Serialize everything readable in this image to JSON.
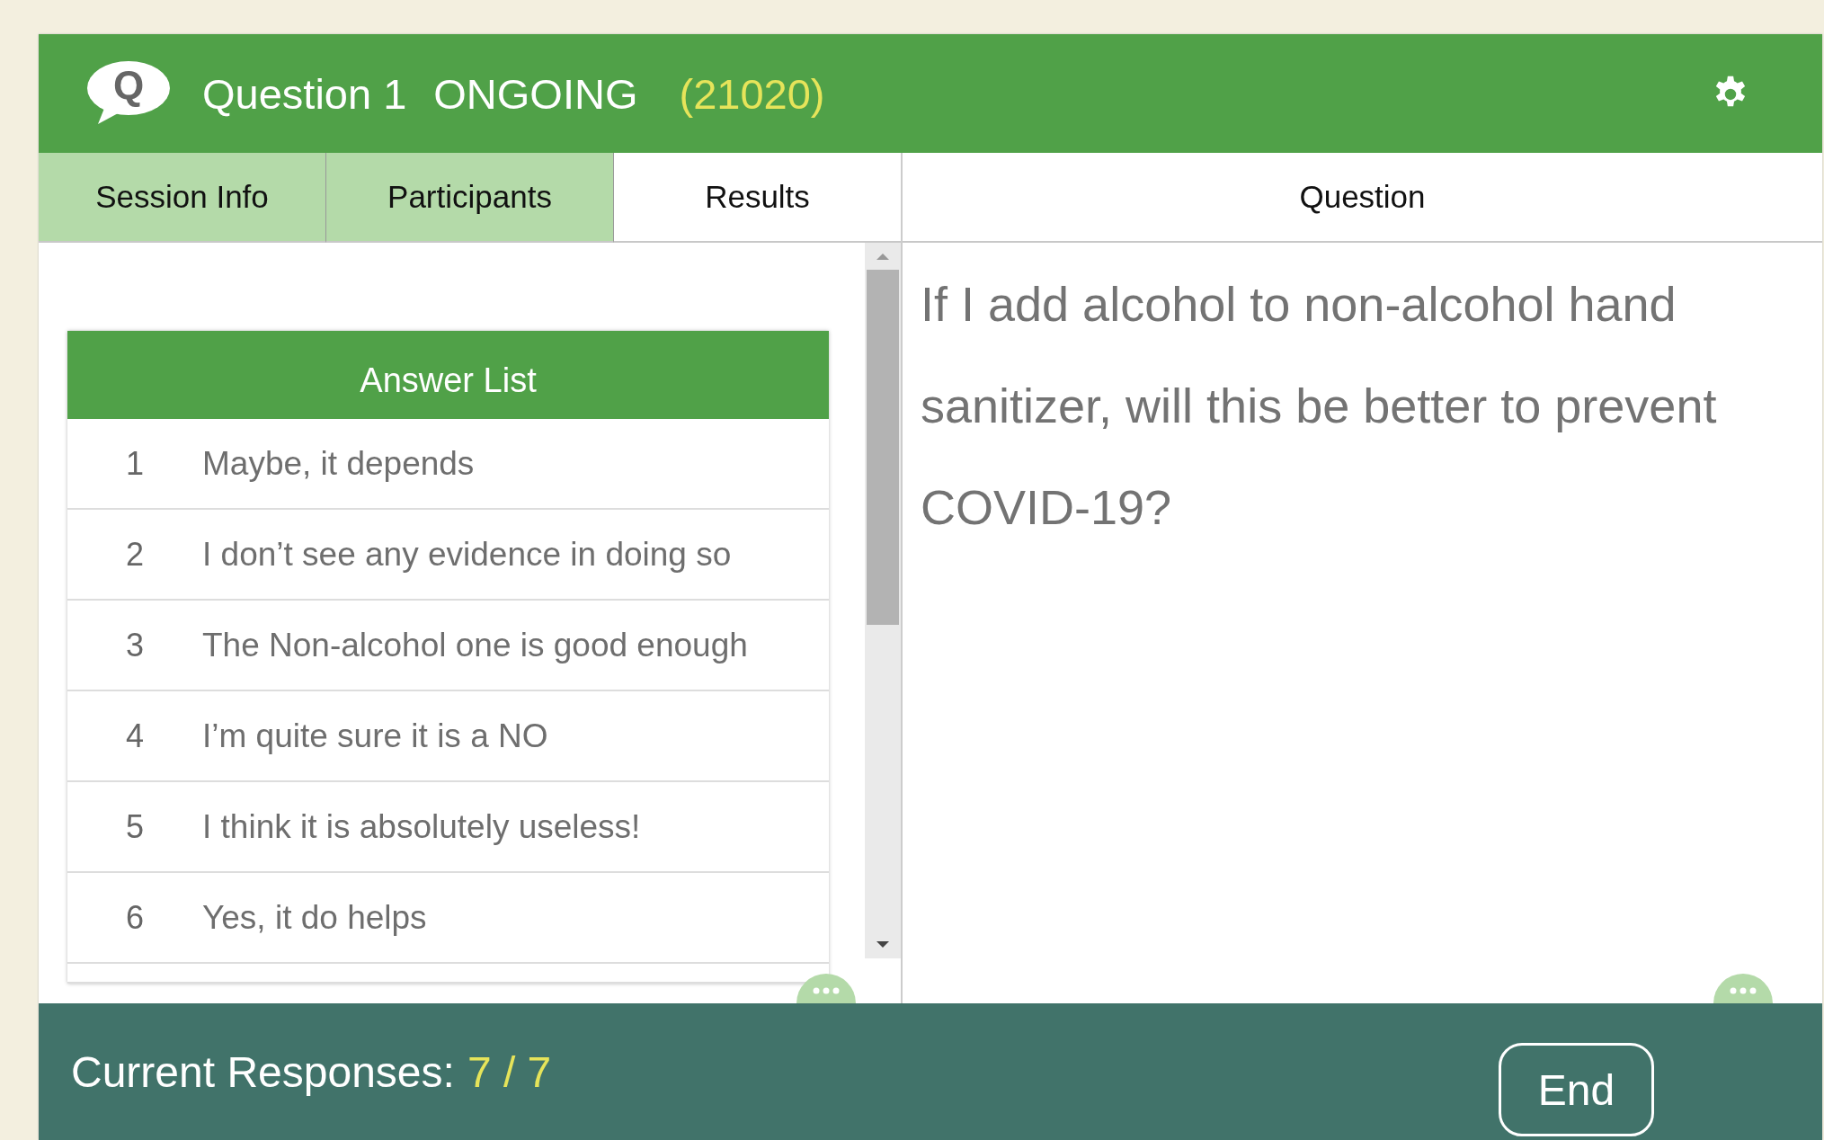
{
  "header": {
    "logo_letter": "Q",
    "title": "Question 1",
    "status": "ONGOING",
    "code": "(21020)"
  },
  "tabs": [
    {
      "label": "Session Info",
      "selected": false
    },
    {
      "label": "Participants",
      "selected": false
    },
    {
      "label": "Results",
      "selected": true
    }
  ],
  "answer_list": {
    "title": "Answer List",
    "rows": [
      {
        "number": "1",
        "answer": "Maybe, it depends"
      },
      {
        "number": "2",
        "answer": "I don’t see any evidence in doing so"
      },
      {
        "number": "3",
        "answer": "The Non-alcohol one is good enough"
      },
      {
        "number": "4",
        "answer": "I’m quite sure it is a NO"
      },
      {
        "number": "5",
        "answer": "I think it is absolutely useless!"
      },
      {
        "number": "6",
        "answer": "Yes, it do helps"
      }
    ]
  },
  "question_panel": {
    "title": "Question",
    "text": "If I add alcohol to non-alcohol hand sanitizer, will this be better to prevent COVID-19?"
  },
  "footer": {
    "label": "Current Responses:",
    "value": "7 / 7",
    "button": "End"
  }
}
